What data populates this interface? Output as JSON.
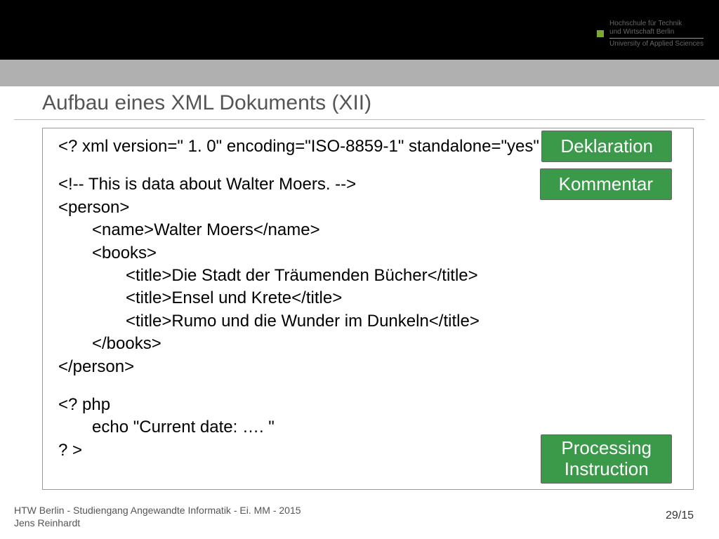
{
  "logo": {
    "mark": "htw",
    "line1": "Hochschule für Technik",
    "line2": "und Wirtschaft Berlin",
    "line3": "University of Applied Sciences"
  },
  "title": "Aufbau eines XML Dokuments (XII)",
  "code": {
    "decl": "<? xml version=\" 1. 0\" encoding=\"ISO-8859-1\" standalone=\"yes\" ? >",
    "comment": "<!-- This is data about Walter Moers. -->",
    "l3": "<person>",
    "l4": "<name>Walter Moers</name>",
    "l5": "<books>",
    "l6": "<title>Die Stadt der Träumenden Bücher</title>",
    "l7": "<title>Ensel und Krete</title>",
    "l8": "<title>Rumo und die Wunder im Dunkeln</title>",
    "l9": "</books>",
    "l10": "</person>",
    "l11": "<? php",
    "l12": "echo \"Current date: …. \"",
    "l13": "? >"
  },
  "badges": {
    "decl": "Deklaration",
    "comment": "Kommentar",
    "pi_line1": "Processing",
    "pi_line2": "Instruction"
  },
  "footer": {
    "line1": "HTW Berlin - Studiengang Angewandte Informatik - Ei. MM - 2015",
    "line2": "Jens Reinhardt"
  },
  "pagenum": "29/15"
}
